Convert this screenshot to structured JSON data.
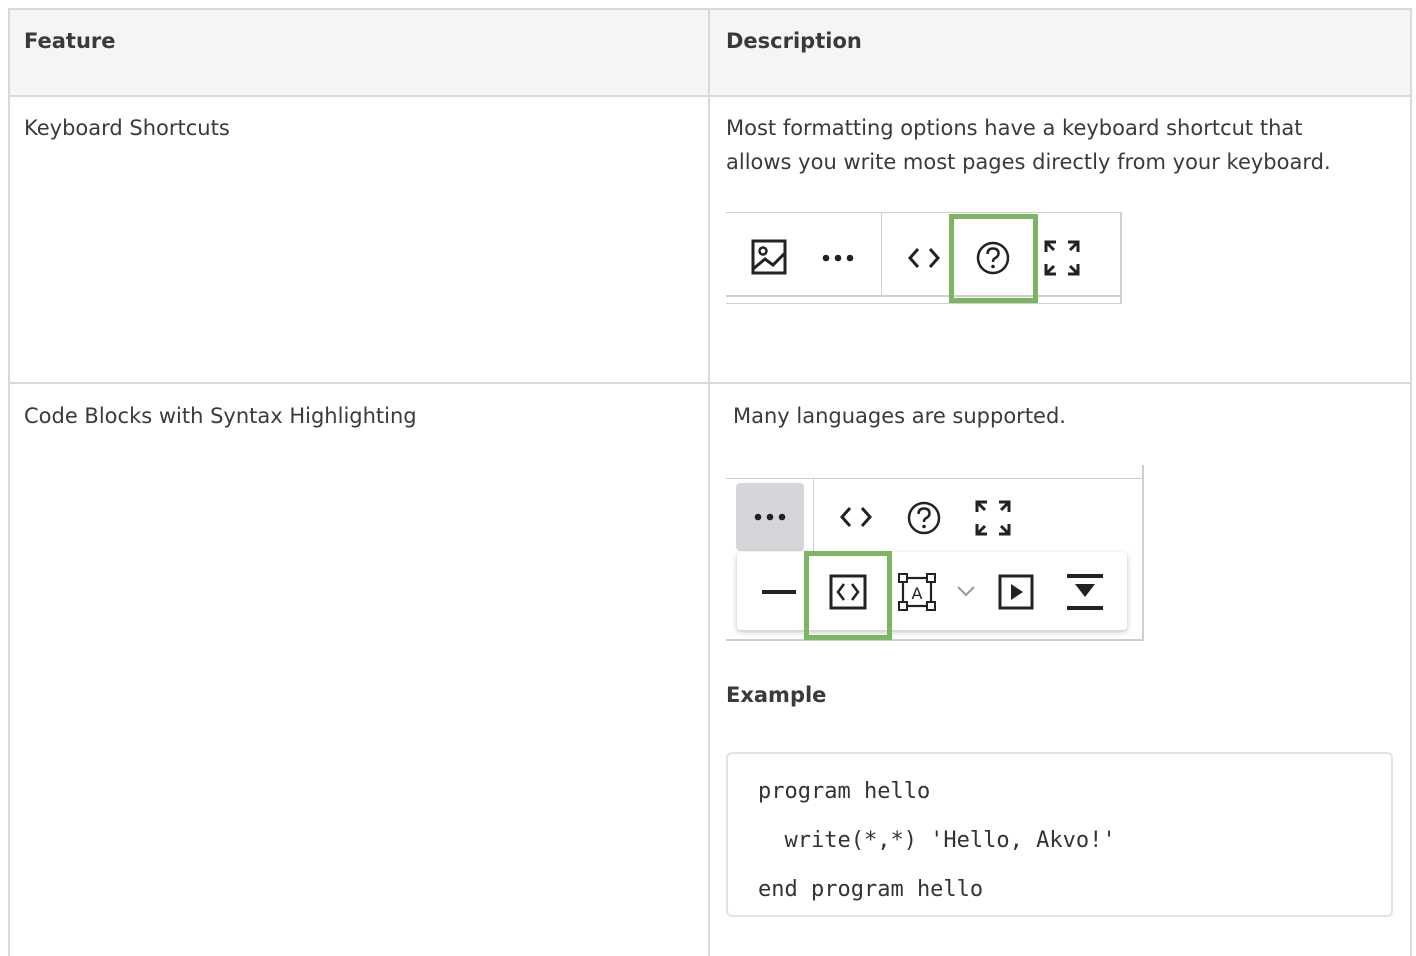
{
  "table": {
    "headers": {
      "feature": "Feature",
      "description": "Description"
    },
    "rows": [
      {
        "feature": "Keyboard Shortcuts",
        "description": "Most formatting options have a keyboard shortcut that allows you write most pages directly from your keyboard.",
        "description_lines": [
          "Most formatting options have a keyboard shortcut that",
          "allows you write most pages directly from your keyboard."
        ]
      },
      {
        "feature": "Code Blocks with Syntax Highlighting",
        "description": "Many languages are supported.",
        "example_heading": "Example",
        "code_lines": [
          "program hello",
          "  write(*,*) 'Hello, Akvo!'",
          "end program hello"
        ]
      }
    ]
  },
  "toolbar1": {
    "icons": [
      "image-icon",
      "more-icon",
      "code-icon",
      "help-icon",
      "fullscreen-icon"
    ],
    "highlighted": "help-icon"
  },
  "toolbar2": {
    "top_icons": [
      "more-icon",
      "code-icon",
      "help-icon",
      "fullscreen-icon"
    ],
    "dropdown_icons": [
      "horizontal-rule-icon",
      "code-block-icon",
      "text-box-icon",
      "chevron-down-icon",
      "media-play-icon",
      "expand-icon"
    ],
    "highlighted": "code-block-icon"
  },
  "colors": {
    "highlight": "#7cb664",
    "header_bg": "#f4f5f7",
    "border": "#d9d9d9",
    "text": "#3a3a3a"
  }
}
